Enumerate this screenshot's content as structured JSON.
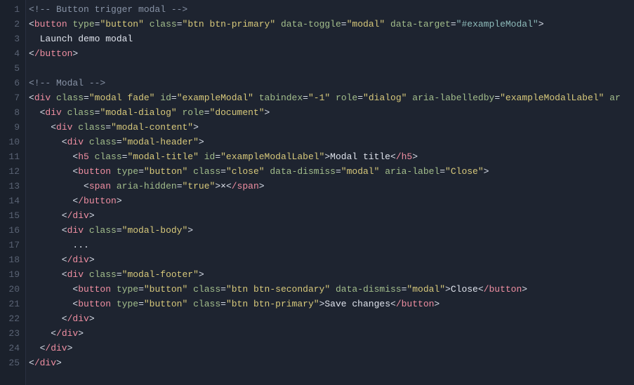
{
  "lineCount": 25,
  "lines": [
    [
      {
        "c": "cmt",
        "t": "<!-- Button trigger modal -->"
      }
    ],
    [
      {
        "c": "p",
        "t": "<"
      },
      {
        "c": "tag",
        "t": "button"
      },
      {
        "c": "p",
        "t": " "
      },
      {
        "c": "attr",
        "t": "type"
      },
      {
        "c": "p",
        "t": "="
      },
      {
        "c": "str",
        "t": "\"button\""
      },
      {
        "c": "p",
        "t": " "
      },
      {
        "c": "attr",
        "t": "class"
      },
      {
        "c": "p",
        "t": "="
      },
      {
        "c": "str",
        "t": "\"btn btn-primary\""
      },
      {
        "c": "p",
        "t": " "
      },
      {
        "c": "attr",
        "t": "data-toggle"
      },
      {
        "c": "p",
        "t": "="
      },
      {
        "c": "str",
        "t": "\"modal\""
      },
      {
        "c": "p",
        "t": " "
      },
      {
        "c": "attr",
        "t": "data-target"
      },
      {
        "c": "p",
        "t": "="
      },
      {
        "c": "strg",
        "t": "\"#exampleModal\""
      },
      {
        "c": "p",
        "t": ">"
      }
    ],
    [
      {
        "c": "txt",
        "t": "  Launch demo modal"
      }
    ],
    [
      {
        "c": "p",
        "t": "<"
      },
      {
        "c": "tag",
        "t": "/button"
      },
      {
        "c": "p",
        "t": ">"
      }
    ],
    [],
    [
      {
        "c": "cmt",
        "t": "<!-- Modal -->"
      }
    ],
    [
      {
        "c": "p",
        "t": "<"
      },
      {
        "c": "tag",
        "t": "div"
      },
      {
        "c": "p",
        "t": " "
      },
      {
        "c": "attr",
        "t": "class"
      },
      {
        "c": "p",
        "t": "="
      },
      {
        "c": "str",
        "t": "\"modal fade\""
      },
      {
        "c": "p",
        "t": " "
      },
      {
        "c": "attr",
        "t": "id"
      },
      {
        "c": "p",
        "t": "="
      },
      {
        "c": "str",
        "t": "\"exampleModal\""
      },
      {
        "c": "p",
        "t": " "
      },
      {
        "c": "attr",
        "t": "tabindex"
      },
      {
        "c": "p",
        "t": "="
      },
      {
        "c": "str",
        "t": "\"-1\""
      },
      {
        "c": "p",
        "t": " "
      },
      {
        "c": "attr",
        "t": "role"
      },
      {
        "c": "p",
        "t": "="
      },
      {
        "c": "str",
        "t": "\"dialog\""
      },
      {
        "c": "p",
        "t": " "
      },
      {
        "c": "attr",
        "t": "aria-labelledby"
      },
      {
        "c": "p",
        "t": "="
      },
      {
        "c": "str",
        "t": "\"exampleModalLabel\""
      },
      {
        "c": "p",
        "t": " "
      },
      {
        "c": "attr",
        "t": "ar"
      }
    ],
    [
      {
        "c": "p",
        "t": "  <"
      },
      {
        "c": "tag",
        "t": "div"
      },
      {
        "c": "p",
        "t": " "
      },
      {
        "c": "attr",
        "t": "class"
      },
      {
        "c": "p",
        "t": "="
      },
      {
        "c": "str",
        "t": "\"modal-dialog\""
      },
      {
        "c": "p",
        "t": " "
      },
      {
        "c": "attr",
        "t": "role"
      },
      {
        "c": "p",
        "t": "="
      },
      {
        "c": "str",
        "t": "\"document\""
      },
      {
        "c": "p",
        "t": ">"
      }
    ],
    [
      {
        "c": "p",
        "t": "    <"
      },
      {
        "c": "tag",
        "t": "div"
      },
      {
        "c": "p",
        "t": " "
      },
      {
        "c": "attr",
        "t": "class"
      },
      {
        "c": "p",
        "t": "="
      },
      {
        "c": "str",
        "t": "\"modal-content\""
      },
      {
        "c": "p",
        "t": ">"
      }
    ],
    [
      {
        "c": "p",
        "t": "      <"
      },
      {
        "c": "tag",
        "t": "div"
      },
      {
        "c": "p",
        "t": " "
      },
      {
        "c": "attr",
        "t": "class"
      },
      {
        "c": "p",
        "t": "="
      },
      {
        "c": "str",
        "t": "\"modal-header\""
      },
      {
        "c": "p",
        "t": ">"
      }
    ],
    [
      {
        "c": "p",
        "t": "        <"
      },
      {
        "c": "tag",
        "t": "h5"
      },
      {
        "c": "p",
        "t": " "
      },
      {
        "c": "attr",
        "t": "class"
      },
      {
        "c": "p",
        "t": "="
      },
      {
        "c": "str",
        "t": "\"modal-title\""
      },
      {
        "c": "p",
        "t": " "
      },
      {
        "c": "attr",
        "t": "id"
      },
      {
        "c": "p",
        "t": "="
      },
      {
        "c": "str",
        "t": "\"exampleModalLabel\""
      },
      {
        "c": "p",
        "t": ">"
      },
      {
        "c": "txt",
        "t": "Modal title"
      },
      {
        "c": "p",
        "t": "<"
      },
      {
        "c": "tag",
        "t": "/h5"
      },
      {
        "c": "p",
        "t": ">"
      }
    ],
    [
      {
        "c": "p",
        "t": "        <"
      },
      {
        "c": "tag",
        "t": "button"
      },
      {
        "c": "p",
        "t": " "
      },
      {
        "c": "attr",
        "t": "type"
      },
      {
        "c": "p",
        "t": "="
      },
      {
        "c": "str",
        "t": "\"button\""
      },
      {
        "c": "p",
        "t": " "
      },
      {
        "c": "attr",
        "t": "class"
      },
      {
        "c": "p",
        "t": "="
      },
      {
        "c": "str",
        "t": "\"close\""
      },
      {
        "c": "p",
        "t": " "
      },
      {
        "c": "attr",
        "t": "data-dismiss"
      },
      {
        "c": "p",
        "t": "="
      },
      {
        "c": "str",
        "t": "\"modal\""
      },
      {
        "c": "p",
        "t": " "
      },
      {
        "c": "attr",
        "t": "aria-label"
      },
      {
        "c": "p",
        "t": "="
      },
      {
        "c": "str",
        "t": "\"Close\""
      },
      {
        "c": "p",
        "t": ">"
      }
    ],
    [
      {
        "c": "p",
        "t": "          <"
      },
      {
        "c": "tag",
        "t": "span"
      },
      {
        "c": "p",
        "t": " "
      },
      {
        "c": "attr",
        "t": "aria-hidden"
      },
      {
        "c": "p",
        "t": "="
      },
      {
        "c": "str",
        "t": "\"true\""
      },
      {
        "c": "p",
        "t": ">"
      },
      {
        "c": "txt",
        "t": "×"
      },
      {
        "c": "p",
        "t": "<"
      },
      {
        "c": "tag",
        "t": "/span"
      },
      {
        "c": "p",
        "t": ">"
      }
    ],
    [
      {
        "c": "p",
        "t": "        <"
      },
      {
        "c": "tag",
        "t": "/button"
      },
      {
        "c": "p",
        "t": ">"
      }
    ],
    [
      {
        "c": "p",
        "t": "      <"
      },
      {
        "c": "tag",
        "t": "/div"
      },
      {
        "c": "p",
        "t": ">"
      }
    ],
    [
      {
        "c": "p",
        "t": "      <"
      },
      {
        "c": "tag",
        "t": "div"
      },
      {
        "c": "p",
        "t": " "
      },
      {
        "c": "attr",
        "t": "class"
      },
      {
        "c": "p",
        "t": "="
      },
      {
        "c": "str",
        "t": "\"modal-body\""
      },
      {
        "c": "p",
        "t": ">"
      }
    ],
    [
      {
        "c": "txt",
        "t": "        ..."
      }
    ],
    [
      {
        "c": "p",
        "t": "      <"
      },
      {
        "c": "tag",
        "t": "/div"
      },
      {
        "c": "p",
        "t": ">"
      }
    ],
    [
      {
        "c": "p",
        "t": "      <"
      },
      {
        "c": "tag",
        "t": "div"
      },
      {
        "c": "p",
        "t": " "
      },
      {
        "c": "attr",
        "t": "class"
      },
      {
        "c": "p",
        "t": "="
      },
      {
        "c": "str",
        "t": "\"modal-footer\""
      },
      {
        "c": "p",
        "t": ">"
      }
    ],
    [
      {
        "c": "p",
        "t": "        <"
      },
      {
        "c": "tag",
        "t": "button"
      },
      {
        "c": "p",
        "t": " "
      },
      {
        "c": "attr",
        "t": "type"
      },
      {
        "c": "p",
        "t": "="
      },
      {
        "c": "str",
        "t": "\"button\""
      },
      {
        "c": "p",
        "t": " "
      },
      {
        "c": "attr",
        "t": "class"
      },
      {
        "c": "p",
        "t": "="
      },
      {
        "c": "str",
        "t": "\"btn btn-secondary\""
      },
      {
        "c": "p",
        "t": " "
      },
      {
        "c": "attr",
        "t": "data-dismiss"
      },
      {
        "c": "p",
        "t": "="
      },
      {
        "c": "str",
        "t": "\"modal\""
      },
      {
        "c": "p",
        "t": ">"
      },
      {
        "c": "txt",
        "t": "Close"
      },
      {
        "c": "p",
        "t": "<"
      },
      {
        "c": "tag",
        "t": "/button"
      },
      {
        "c": "p",
        "t": ">"
      }
    ],
    [
      {
        "c": "p",
        "t": "        <"
      },
      {
        "c": "tag",
        "t": "button"
      },
      {
        "c": "p",
        "t": " "
      },
      {
        "c": "attr",
        "t": "type"
      },
      {
        "c": "p",
        "t": "="
      },
      {
        "c": "str",
        "t": "\"button\""
      },
      {
        "c": "p",
        "t": " "
      },
      {
        "c": "attr",
        "t": "class"
      },
      {
        "c": "p",
        "t": "="
      },
      {
        "c": "str",
        "t": "\"btn btn-primary\""
      },
      {
        "c": "p",
        "t": ">"
      },
      {
        "c": "txt",
        "t": "Save changes"
      },
      {
        "c": "p",
        "t": "<"
      },
      {
        "c": "tag",
        "t": "/button"
      },
      {
        "c": "p",
        "t": ">"
      }
    ],
    [
      {
        "c": "p",
        "t": "      <"
      },
      {
        "c": "tag",
        "t": "/div"
      },
      {
        "c": "p",
        "t": ">"
      }
    ],
    [
      {
        "c": "p",
        "t": "    <"
      },
      {
        "c": "tag",
        "t": "/div"
      },
      {
        "c": "p",
        "t": ">"
      }
    ],
    [
      {
        "c": "p",
        "t": "  <"
      },
      {
        "c": "tag",
        "t": "/div"
      },
      {
        "c": "p",
        "t": ">"
      }
    ],
    [
      {
        "c": "p",
        "t": "<"
      },
      {
        "c": "tag",
        "t": "/div"
      },
      {
        "c": "p",
        "t": ">"
      }
    ]
  ]
}
